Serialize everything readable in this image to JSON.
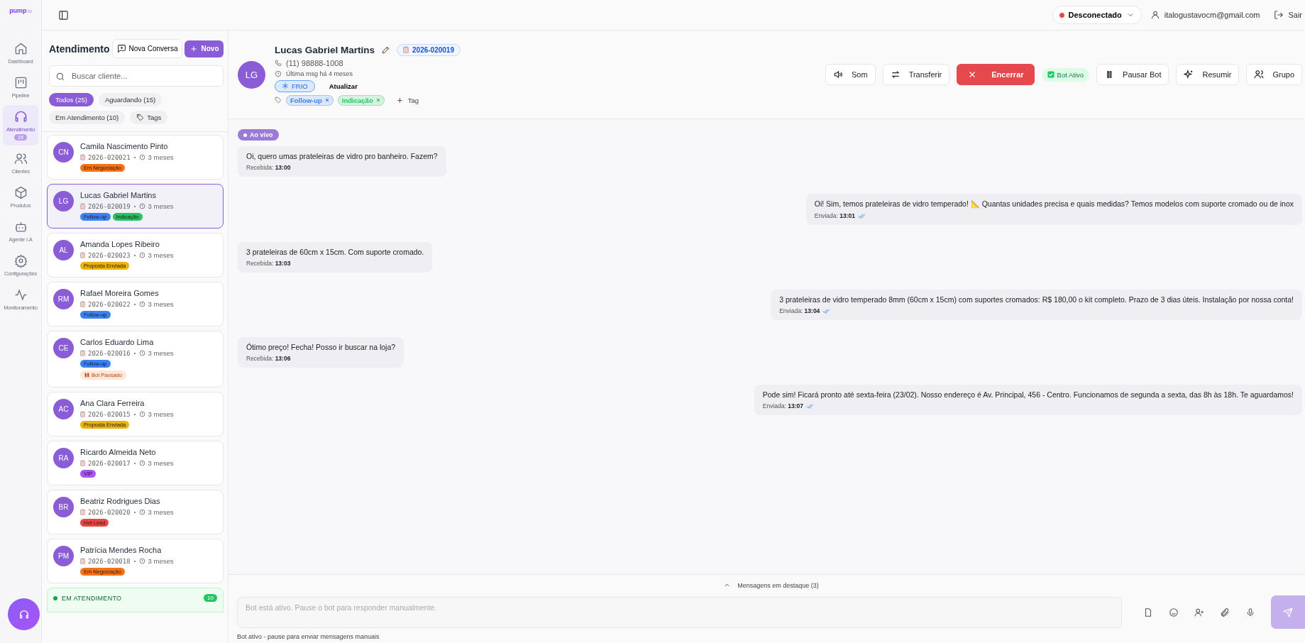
{
  "logo": {
    "name": "pump",
    "suffix": "io"
  },
  "nav": [
    {
      "label": "Dashboard",
      "selected": false
    },
    {
      "label": "Pipeline",
      "selected": false
    },
    {
      "label": "Atendimento",
      "selected": true,
      "badge": "15"
    },
    {
      "label": "Clientes",
      "selected": false
    },
    {
      "label": "Produtos",
      "selected": false
    },
    {
      "label": "Agente I.A",
      "selected": false
    },
    {
      "label": "Configurações",
      "selected": false
    },
    {
      "label": "Monitoramento",
      "selected": false
    }
  ],
  "topbar": {
    "status": {
      "label": "Desconectado",
      "connected": false
    },
    "email": "italogustavocm@gmail.com",
    "logout": "Sair"
  },
  "list": {
    "title": "Atendimento",
    "new_conversation": "Nova Conversa",
    "new": "Novo",
    "search": {
      "placeholder": "Buscar cliente..."
    },
    "filters": [
      {
        "label": "Todos (25)",
        "kind": "text",
        "selected": true
      },
      {
        "label": "Aguardando (15)",
        "kind": "text",
        "selected": false
      },
      {
        "label": "Em Atendimento (10)",
        "kind": "text",
        "selected": false
      },
      {
        "label": "Tags",
        "kind": "tag",
        "selected": false
      }
    ],
    "cards": [
      {
        "initials": "CN",
        "name": "Camila Nascimento Pinto",
        "code": "2026-020021",
        "age": "3 meses",
        "selected": false,
        "tags": [
          {
            "label": "Em Negociação",
            "color": "#f97316"
          }
        ]
      },
      {
        "initials": "LG",
        "name": "Lucas Gabriel Martins",
        "code": "2026-020019",
        "age": "3 meses",
        "selected": true,
        "tags": [
          {
            "label": "Follow-up",
            "color": "#3b82f6"
          },
          {
            "label": "Indicação",
            "color": "#22c55e"
          }
        ]
      },
      {
        "initials": "AL",
        "name": "Amanda Lopes Ribeiro",
        "code": "2026-020023",
        "age": "3 meses",
        "selected": false,
        "tags": [
          {
            "label": "Proposta Enviada",
            "color": "#eab308"
          }
        ]
      },
      {
        "initials": "RM",
        "name": "Rafael Moreira Gomes",
        "code": "2026-020022",
        "age": "3 meses",
        "selected": false,
        "tags": [
          {
            "label": "Follow-up",
            "color": "#3b82f6"
          }
        ]
      },
      {
        "initials": "CE",
        "name": "Carlos Eduardo Lima",
        "code": "2026-020016",
        "age": "3 meses",
        "selected": false,
        "tags": [
          {
            "label": "Follow-up",
            "color": "#3b82f6"
          }
        ],
        "paused": "Bot Pausado"
      },
      {
        "initials": "AC",
        "name": "Ana Clara Ferreira",
        "code": "2026-020015",
        "age": "3 meses",
        "selected": false,
        "tags": [
          {
            "label": "Proposta Enviada",
            "color": "#eab308"
          }
        ]
      },
      {
        "initials": "RA",
        "name": "Ricardo Almeida Neto",
        "code": "2026-020017",
        "age": "3 meses",
        "selected": false,
        "tags": [
          {
            "label": "VIP",
            "color": "#a855f7"
          }
        ]
      },
      {
        "initials": "BR",
        "name": "Beatriz Rodrigues Dias",
        "code": "2026-020020",
        "age": "3 meses",
        "selected": false,
        "tags": [
          {
            "label": "Hot Lead",
            "color": "#ef4444"
          }
        ]
      },
      {
        "initials": "PM",
        "name": "Patrícia Mendes Rocha",
        "code": "2026-020018",
        "age": "3 meses",
        "selected": false,
        "tags": [
          {
            "label": "Em Negociação",
            "color": "#f97316"
          }
        ]
      }
    ],
    "section": {
      "label": "EM ATENDIMENTO",
      "count": "10"
    }
  },
  "chat": {
    "contact": {
      "initials": "LG",
      "name": "Lucas Gabriel Martins",
      "code": "2026-020019",
      "phone": "(11) 98888-1008",
      "last": "Última msg há 4 meses",
      "temperature": "FRIO",
      "update": "Atualizar",
      "tags": [
        {
          "label": "Follow-up",
          "color": "#3b82f6"
        },
        {
          "label": "Indicação",
          "color": "#22c55e"
        }
      ],
      "add_tag": "Tag"
    },
    "actions": [
      {
        "label": "Som",
        "kind": "sound"
      },
      {
        "label": "Transferir",
        "kind": "transfer"
      },
      {
        "label": "Encerrar",
        "kind": "close"
      },
      {
        "label": "Bot Ativo",
        "kind": "status"
      },
      {
        "label": "Pausar Bot",
        "kind": "pause"
      },
      {
        "label": "Resumir",
        "kind": "sparkle"
      },
      {
        "label": "Grupo",
        "kind": "group"
      }
    ],
    "live": "Ao vivo",
    "messages": [
      {
        "kind": "in",
        "text": "Oi, quero umas prateleiras de vidro pro banheiro. Fazem?",
        "status": "Recebida:",
        "time": "13:00"
      },
      {
        "kind": "out",
        "text": "Oi! Sim, temos prateleiras de vidro temperado! 📐 Quantas unidades precisa e quais medidas? Temos modelos com suporte cromado ou de inox",
        "status": "Enviada:",
        "time": "13:01"
      },
      {
        "kind": "in",
        "text": "3 prateleiras de 60cm x 15cm. Com suporte cromado.",
        "status": "Recebida:",
        "time": "13:03"
      },
      {
        "kind": "out",
        "text": "3 prateleiras de vidro temperado 8mm (60cm x 15cm) com suportes cromados: R$ 180,00 o kit completo. Prazo de 3 dias úteis. Instalação por nossa conta!",
        "status": "Enviada:",
        "time": "13:04"
      },
      {
        "kind": "in",
        "text": "Ótimo preço! Fecha! Posso ir buscar na loja?",
        "status": "Recebida:",
        "time": "13:06"
      },
      {
        "kind": "out",
        "text": "Pode sim! Ficará pronto até sexta-feira (23/02). Nosso endereço é Av. Principal, 456 - Centro. Funcionamos de segunda a sexta, das 8h às 18h. Te aguardamos!",
        "status": "Enviada:",
        "time": "13:07"
      }
    ],
    "highlights": "Mensagens em destaque (3)",
    "composer": {
      "placeholder": "Bot está ativo. Pause o bot para responder manualmente.",
      "disabled": true
    },
    "hint": "Bot ativo - pause para enviar mensagens manuais"
  }
}
